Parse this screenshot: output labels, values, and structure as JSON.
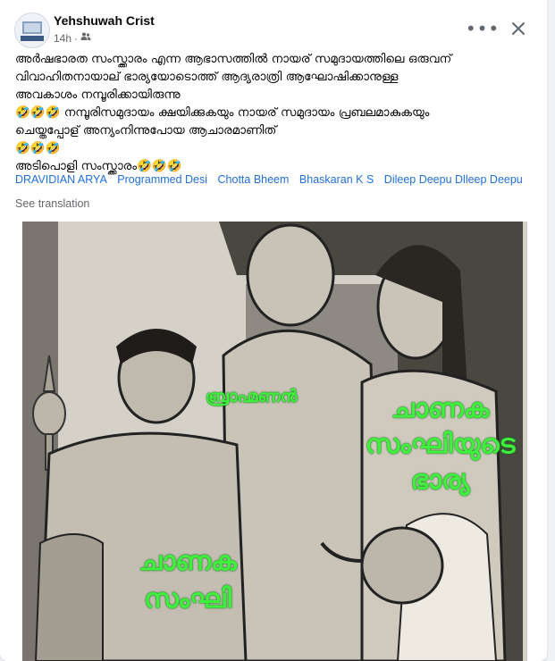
{
  "post": {
    "author": "Yehshuwah Crist",
    "time": "14h",
    "privacy_icon": "friends-icon",
    "more_icon": "more-horizontal-icon",
    "close_icon": "close-icon",
    "text_lines": [
      "അർഷഭാരത സംസ്ക്കാരം എന്ന ആഭാസത്തിൽ നായര് സമുദായത്തിലെ ഒരുവന്",
      "വിവാഹിതനായാല് ഭാര്യയോടൊത്ത് ആദ്യരാത്രി ആഘോഷിക്കാനുള്ള",
      "അവകാശം നമ്പൂരിക്കായിരുന്നു",
      "🤣🤣🤣 നമ്പൂരിസമുദായം ക്ഷയിക്കുകയും    നായര് സമുദായം പ്രബലമാകുകയും",
      "ചെയ്തപ്പോള് അന്യംനിന്നുപോയ ആചാരമാണിത്",
      "🤣🤣🤣",
      "അടിപൊളി സംസ്ക്കാരം🤣🤣🤣"
    ],
    "tags": [
      "DRAVIDIAN ARYA",
      "Programmed Desi",
      "Chotta Bheem",
      "Bhaskaran K S",
      "Dileep Deepu Dlleep Deepu"
    ],
    "see_translation": "See translation"
  },
  "image": {
    "labels": {
      "brahmin": "ബ്രാഹ്മണൻ",
      "wife_line1": "ചാണക",
      "wife_line2": "സംഘിയുടെ",
      "wife_line3": "ഭാര്യ",
      "sanghi_line1": "ചാണക",
      "sanghi_line2": "സംഘി"
    },
    "overlay_color": "#3ff03f"
  }
}
